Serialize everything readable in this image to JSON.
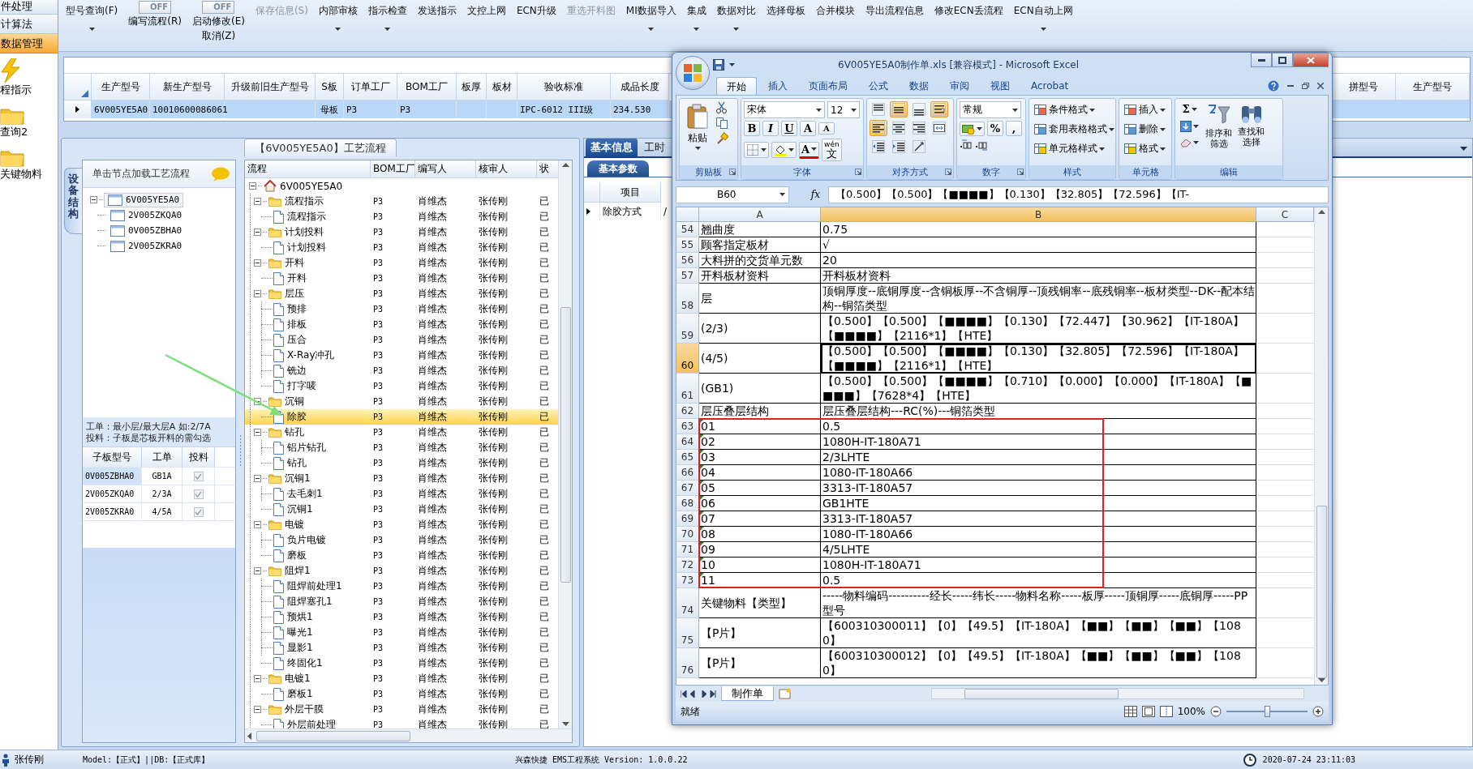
{
  "nav": [
    {
      "kind": "text",
      "label": "件处理",
      "selected": false
    },
    {
      "kind": "text",
      "label": "计算法",
      "selected": false
    },
    {
      "kind": "text",
      "label": "数据管理",
      "selected": true
    },
    {
      "kind": "tool",
      "label": "程指示",
      "selected": false
    },
    {
      "kind": "tool",
      "label": "查询2",
      "selected": false
    },
    {
      "kind": "tool",
      "label": "关键物料",
      "selected": false
    }
  ],
  "toolbar": [
    {
      "kind": "button",
      "label": "型号查询(F)",
      "dropdown": true,
      "disabled": false
    },
    {
      "kind": "toggle",
      "switch": "OFF",
      "on": false,
      "label": "编写流程(R)"
    },
    {
      "kind": "toggle",
      "switch": "OFF",
      "on": false,
      "label": "启动修改(E)",
      "sublabel": "取消(Z)"
    },
    {
      "kind": "button",
      "label": "保存信息(S)",
      "dropdown": false,
      "disabled": true
    },
    {
      "kind": "button",
      "label": "内部审核",
      "dropdown": true,
      "disabled": false
    },
    {
      "kind": "button",
      "label": "指示检查",
      "dropdown": true,
      "disabled": false
    },
    {
      "kind": "button",
      "label": "发送指示",
      "dropdown": false,
      "disabled": false
    },
    {
      "kind": "button",
      "label": "文控上网",
      "dropdown": false,
      "disabled": false
    },
    {
      "kind": "button",
      "label": "ECN升级",
      "dropdown": false,
      "disabled": false
    },
    {
      "kind": "button",
      "label": "重选开料图",
      "dropdown": false,
      "disabled": true
    },
    {
      "kind": "button",
      "label": "MI数据导入",
      "dropdown": true,
      "disabled": false
    },
    {
      "kind": "button",
      "label": "集成",
      "dropdown": true,
      "disabled": false
    },
    {
      "kind": "button",
      "label": "数据对比",
      "dropdown": true,
      "disabled": false
    },
    {
      "kind": "button",
      "label": "选择母板",
      "dropdown": false,
      "disabled": false
    },
    {
      "kind": "button",
      "label": "合并模块",
      "dropdown": false,
      "disabled": false
    },
    {
      "kind": "button",
      "label": "导出流程信息",
      "dropdown": false,
      "disabled": false
    },
    {
      "kind": "button",
      "label": "修改ECN丢流程",
      "dropdown": false,
      "disabled": false
    },
    {
      "kind": "button",
      "label": "ECN自动上网",
      "dropdown": true,
      "disabled": false
    }
  ],
  "order_grid": {
    "columns": [
      "生产型号",
      "新生产型号",
      "升级前旧生产型号",
      "S板",
      "订单工厂",
      "BOM工厂",
      "板厚",
      "板材",
      "验收标准",
      "成品长度"
    ],
    "extra_columns": [
      "拼型号",
      "生产型号"
    ],
    "rows": [
      {
        "selected": true,
        "cells": [
          "6V005YE5A0",
          "10010600086061",
          null,
          "母板",
          "P3",
          "P3",
          null,
          null,
          "IPC-6012 III级",
          "234.530"
        ]
      }
    ]
  },
  "process": {
    "title": "【6V005YE5A0】工艺流程",
    "side_tab": "设备结构",
    "hint": "单击节点加载工艺流程",
    "structure": [
      {
        "label": "6V005YE5A0",
        "selected": true,
        "expanded": true,
        "children": [
          {
            "label": "2V005ZKQA0",
            "selected": false
          },
          {
            "label": "0V005ZBHA0",
            "selected": false
          },
          {
            "label": "2V005ZKRA0",
            "selected": false
          }
        ]
      }
    ],
    "note_lines": [
      "工单：最小层/最大层A 如:2/7A",
      "投料：子板是芯板开料的需勾选"
    ],
    "sub_grid": {
      "columns": [
        "子板型号",
        "工单",
        "投料"
      ],
      "rows": [
        {
          "cells": [
            "0V005ZBHA0",
            "GB1A"
          ],
          "checked": true,
          "disabled": true,
          "selected": true
        },
        {
          "cells": [
            "2V005ZKQA0",
            "2/3A"
          ],
          "checked": true,
          "disabled": true,
          "selected": false
        },
        {
          "cells": [
            "2V005ZKRA0",
            "4/5A"
          ],
          "checked": true,
          "disabled": true,
          "selected": false
        }
      ]
    },
    "flow": {
      "columns": [
        "流程",
        "BOM工厂",
        "编写人",
        "核审人",
        "状"
      ],
      "tree": [
        {
          "label": "6V005YE5A0",
          "expanded": true,
          "selected": false,
          "children": [
            {
              "label": "流程指示",
              "expanded": true,
              "selected": false,
              "cells": [
                "P3",
                "肖维杰",
                "张传刚",
                "已"
              ],
              "children": [
                {
                  "label": "流程指示",
                  "selected": false,
                  "cells": [
                    "P3",
                    "肖维杰",
                    "张传刚",
                    "已"
                  ]
                }
              ]
            },
            {
              "label": "计划投料",
              "expanded": true,
              "selected": false,
              "cells": [
                "P3",
                "肖维杰",
                "张传刚",
                "已"
              ],
              "children": [
                {
                  "label": "计划投料",
                  "selected": false,
                  "cells": [
                    "P3",
                    "肖维杰",
                    "张传刚",
                    "已"
                  ]
                }
              ]
            },
            {
              "label": "开料",
              "expanded": true,
              "selected": false,
              "cells": [
                "P3",
                "肖维杰",
                "张传刚",
                "已"
              ],
              "children": [
                {
                  "label": "开料",
                  "selected": false,
                  "cells": [
                    "P3",
                    "肖维杰",
                    "张传刚",
                    "已"
                  ]
                }
              ]
            },
            {
              "label": "层压",
              "expanded": true,
              "selected": false,
              "cells": [
                "P3",
                "肖维杰",
                "张传刚",
                "已"
              ],
              "children": [
                {
                  "label": "预排",
                  "selected": false,
                  "cells": [
                    "P3",
                    "肖维杰",
                    "张传刚",
                    "已"
                  ]
                },
                {
                  "label": "排板",
                  "selected": false,
                  "cells": [
                    "P3",
                    "肖维杰",
                    "张传刚",
                    "已"
                  ]
                },
                {
                  "label": "压合",
                  "selected": false,
                  "cells": [
                    "P3",
                    "肖维杰",
                    "张传刚",
                    "已"
                  ]
                },
                {
                  "label": "X-Ray冲孔",
                  "selected": false,
                  "cells": [
                    "P3",
                    "肖维杰",
                    "张传刚",
                    "已"
                  ]
                },
                {
                  "label": "铣边",
                  "selected": false,
                  "cells": [
                    "P3",
                    "肖维杰",
                    "张传刚",
                    "已"
                  ]
                },
                {
                  "label": "打字唛",
                  "selected": false,
                  "cells": [
                    "P3",
                    "肖维杰",
                    "张传刚",
                    "已"
                  ]
                }
              ]
            },
            {
              "label": "沉铜",
              "expanded": true,
              "selected": false,
              "cells": [
                "P3",
                "肖维杰",
                "张传刚",
                "已"
              ],
              "children": [
                {
                  "label": "除胶",
                  "selected": true,
                  "cells": [
                    "P3",
                    "肖维杰",
                    "张传刚",
                    "已"
                  ]
                }
              ]
            },
            {
              "label": "钻孔",
              "expanded": true,
              "selected": false,
              "cells": [
                "P3",
                "肖维杰",
                "张传刚",
                "已"
              ],
              "children": [
                {
                  "label": "铝片钻孔",
                  "selected": false,
                  "cells": [
                    "P3",
                    "肖维杰",
                    "张传刚",
                    "已"
                  ]
                },
                {
                  "label": "钻孔",
                  "selected": false,
                  "cells": [
                    "P3",
                    "肖维杰",
                    "张传刚",
                    "已"
                  ]
                }
              ]
            },
            {
              "label": "沉铜1",
              "expanded": true,
              "selected": false,
              "cells": [
                "P3",
                "肖维杰",
                "张传刚",
                "已"
              ],
              "children": [
                {
                  "label": "去毛刺1",
                  "selected": false,
                  "cells": [
                    "P3",
                    "肖维杰",
                    "张传刚",
                    "已"
                  ]
                },
                {
                  "label": "沉铜1",
                  "selected": false,
                  "cells": [
                    "P3",
                    "肖维杰",
                    "张传刚",
                    "已"
                  ]
                }
              ]
            },
            {
              "label": "电镀",
              "expanded": true,
              "selected": false,
              "cells": [
                "P3",
                "肖维杰",
                "张传刚",
                "已"
              ],
              "children": [
                {
                  "label": "负片电镀",
                  "selected": false,
                  "cells": [
                    "P3",
                    "肖维杰",
                    "张传刚",
                    "已"
                  ]
                },
                {
                  "label": "磨板",
                  "selected": false,
                  "cells": [
                    "P3",
                    "肖维杰",
                    "张传刚",
                    "已"
                  ]
                }
              ]
            },
            {
              "label": "阻焊1",
              "expanded": true,
              "selected": false,
              "cells": [
                "P3",
                "肖维杰",
                "张传刚",
                "已"
              ],
              "children": [
                {
                  "label": "阻焊前处理1",
                  "selected": false,
                  "cells": [
                    "P3",
                    "肖维杰",
                    "张传刚",
                    "已"
                  ]
                },
                {
                  "label": "阻焊塞孔1",
                  "selected": false,
                  "cells": [
                    "P3",
                    "肖维杰",
                    "张传刚",
                    "已"
                  ]
                },
                {
                  "label": "预烘1",
                  "selected": false,
                  "cells": [
                    "P3",
                    "肖维杰",
                    "张传刚",
                    "已"
                  ]
                },
                {
                  "label": "曝光1",
                  "selected": false,
                  "cells": [
                    "P3",
                    "肖维杰",
                    "张传刚",
                    "已"
                  ]
                },
                {
                  "label": "显影1",
                  "selected": false,
                  "cells": [
                    "P3",
                    "肖维杰",
                    "张传刚",
                    "已"
                  ]
                },
                {
                  "label": "终固化1",
                  "selected": false,
                  "cells": [
                    "P3",
                    "肖维杰",
                    "张传刚",
                    "已"
                  ]
                }
              ]
            },
            {
              "label": "电镀1",
              "expanded": true,
              "selected": false,
              "cells": [
                "P3",
                "肖维杰",
                "张传刚",
                "已"
              ],
              "children": [
                {
                  "label": "磨板1",
                  "selected": false,
                  "cells": [
                    "P3",
                    "肖维杰",
                    "张传刚",
                    "已"
                  ]
                }
              ]
            },
            {
              "label": "外层干膜",
              "expanded": true,
              "selected": false,
              "cells": [
                "P3",
                "肖维杰",
                "张传刚",
                "已"
              ],
              "children": [
                {
                  "label": "外层前处理",
                  "selected": false,
                  "cells": [
                    "P3",
                    "肖维杰",
                    "张传刚",
                    "已"
                  ]
                }
              ]
            }
          ]
        }
      ]
    }
  },
  "detail": {
    "tabs": [
      {
        "label": "基本信息",
        "selected": true
      },
      {
        "label": "工时",
        "selected": false
      }
    ],
    "subtab": "基本参数",
    "columns": [
      "项目"
    ],
    "rows": [
      {
        "cells": [
          "除胶方式",
          "/"
        ]
      }
    ]
  },
  "excel": {
    "title": "6V005YE5A0制作单.xls  [兼容模式] - Microsoft Excel",
    "tabs": [
      {
        "label": "开始",
        "selected": true
      },
      {
        "label": "插入",
        "selected": false
      },
      {
        "label": "页面布局",
        "selected": false
      },
      {
        "label": "公式",
        "selected": false
      },
      {
        "label": "数据",
        "selected": false
      },
      {
        "label": "审阅",
        "selected": false
      },
      {
        "label": "视图",
        "selected": false
      },
      {
        "label": "Acrobat",
        "selected": false
      }
    ],
    "ribbon": [
      {
        "label": "剪贴板",
        "launcher": true,
        "items": [
          "粘贴"
        ]
      },
      {
        "label": "字体",
        "launcher": true,
        "items": [
          "宋体",
          "12",
          "B",
          "I",
          "U",
          "A",
          "A",
          "A",
          "wén",
          "文"
        ]
      },
      {
        "label": "对齐方式",
        "launcher": true,
        "buttons": [
          {
            "selected": false
          },
          {
            "selected": true
          },
          {
            "selected": false
          },
          {
            "selected": true
          },
          {
            "selected": true
          },
          {
            "selected": false
          },
          {
            "selected": false
          },
          {
            "selected": false
          },
          {
            "selected": false
          },
          {
            "selected": false
          },
          {
            "selected": false
          }
        ]
      },
      {
        "label": "数字",
        "launcher": true,
        "items": [
          "常规",
          "%",
          ","
        ]
      },
      {
        "label": "样式",
        "launcher": false,
        "items": [
          "条件格式",
          "套用表格格式",
          "单元格样式"
        ]
      },
      {
        "label": "单元格",
        "launcher": false,
        "items": [
          "插入",
          "删除",
          "格式"
        ]
      },
      {
        "label": "编辑",
        "launcher": false,
        "items": [
          "Σ",
          "排序和筛选",
          "查找和选择"
        ]
      }
    ],
    "name_box": "B60",
    "fx": "fx",
    "formula": "【0.500】【0.500】【■■■■】【0.130】【32.805】【72.596】【IT-",
    "columns": [
      {
        "label": "A",
        "selected": false
      },
      {
        "label": "B",
        "selected": true
      },
      {
        "label": "C",
        "selected": false
      }
    ],
    "rows": [
      {
        "row": "54",
        "a": "翘曲度",
        "b": "0.75",
        "flag": false,
        "selected": false
      },
      {
        "row": "55",
        "a": "顾客指定板材",
        "b": "√",
        "flag": false,
        "selected": false
      },
      {
        "row": "56",
        "a": "大料拼的交货单元数",
        "b": "20",
        "flag": false,
        "selected": false
      },
      {
        "row": "57",
        "a": "开料板材资料",
        "b": "开料板材资料",
        "flag": false,
        "selected": false
      },
      {
        "row": "58",
        "a": "层",
        "b": "顶铜厚度--底铜厚度--含铜板厚--不含铜厚--顶残铜率--底残铜率--板材类型--DK--配本结构--铜箔类型",
        "flag": false,
        "selected": false
      },
      {
        "row": "59",
        "a": "(2/3)",
        "b": "【0.500】【0.500】【■■■■】【0.130】【72.447】【30.962】【IT-180A】【■■■■】【2116*1】【HTE】",
        "flag": false,
        "selected": false
      },
      {
        "row": "60",
        "a": "(4/5)",
        "b": "【0.500】【0.500】【■■■■】【0.130】【32.805】【72.596】【IT-180A】【■■■■】【2116*1】【HTE】",
        "flag": false,
        "selected": true
      },
      {
        "row": "61",
        "a": "(GB1)",
        "b": "【0.500】【0.500】【■■■■】【0.710】【0.000】【0.000】【IT-180A】【■■■■】【7628*4】【HTE】",
        "flag": false,
        "selected": false
      },
      {
        "row": "62",
        "a": "层压叠层结构",
        "b": "层压叠层结构---RC(%)---铜箔类型",
        "flag": false,
        "selected": false
      },
      {
        "row": "63",
        "a": "01",
        "b": "0.5",
        "flag": true,
        "selected": false
      },
      {
        "row": "64",
        "a": "02",
        "b": "1080H-IT-180A71",
        "flag": true,
        "selected": false
      },
      {
        "row": "65",
        "a": "03",
        "b": "2/3LHTE",
        "flag": true,
        "selected": false
      },
      {
        "row": "66",
        "a": "04",
        "b": "1080-IT-180A66",
        "flag": true,
        "selected": false
      },
      {
        "row": "67",
        "a": "05",
        "b": "3313-IT-180A57",
        "flag": true,
        "selected": false
      },
      {
        "row": "68",
        "a": "06",
        "b": "GB1HTE",
        "flag": true,
        "selected": false
      },
      {
        "row": "69",
        "a": "07",
        "b": "3313-IT-180A57",
        "flag": true,
        "selected": false
      },
      {
        "row": "70",
        "a": "08",
        "b": "1080-IT-180A66",
        "flag": true,
        "selected": false
      },
      {
        "row": "71",
        "a": "09",
        "b": "4/5LHTE",
        "flag": true,
        "selected": false
      },
      {
        "row": "72",
        "a": "10",
        "b": "1080H-IT-180A71",
        "flag": true,
        "selected": false
      },
      {
        "row": "73",
        "a": "11",
        "b": "0.5",
        "flag": true,
        "selected": false
      },
      {
        "row": "74",
        "a": "关键物料【类型】",
        "b": "-----物料编码----------经长-----纬长-----物料名称-----板厚-----顶铜厚-----底铜厚-----PP型号",
        "flag": false,
        "selected": false
      },
      {
        "row": "75",
        "a": "【P片】",
        "b": "【600310300011】【0】【49.5】【IT-180A】【■■】【■■】【■■】【1080】",
        "flag": false,
        "selected": false
      },
      {
        "row": "76",
        "a": "【P片】",
        "b": "【600310300012】【0】【49.5】【IT-180A】【■■】【■■】【■■】【1080】",
        "flag": false,
        "selected": false
      }
    ],
    "sheets": [
      {
        "label": "制作单",
        "selected": true
      }
    ],
    "ready": "就绪",
    "zoom": "100%",
    "zoom_slider": {
      "level": 0.5
    }
  },
  "status": {
    "user": "张传刚",
    "model": "Model:【正式】||DB:【正式库】",
    "app": "兴森快捷 EMS工程系统 Version: 1.0.0.22",
    "time": "2020-07-24 23:11:03"
  }
}
